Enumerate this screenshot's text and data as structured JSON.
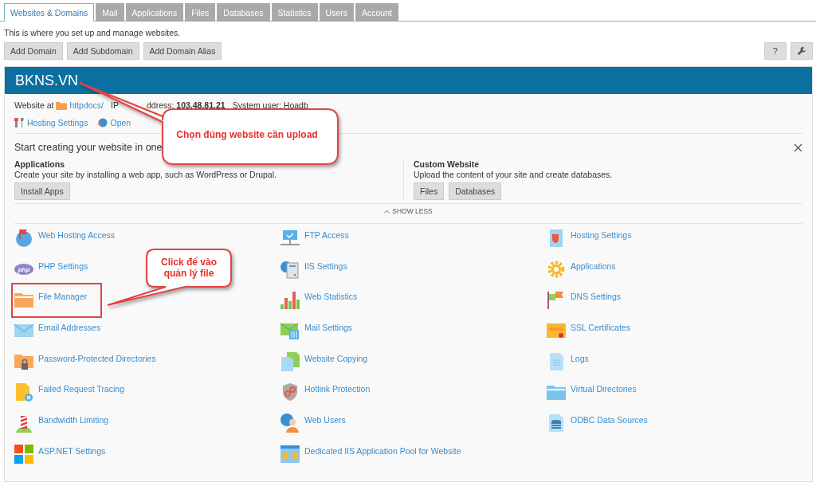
{
  "tabs": [
    {
      "label": "Websites & Domains",
      "selected": true
    },
    {
      "label": "Mail",
      "selected": false
    },
    {
      "label": "Applications",
      "selected": false
    },
    {
      "label": "Files",
      "selected": false
    },
    {
      "label": "Databases",
      "selected": false
    },
    {
      "label": "Statistics",
      "selected": false
    },
    {
      "label": "Users",
      "selected": false
    },
    {
      "label": "Account",
      "selected": false
    }
  ],
  "description": "This is where you set up and manage websites.",
  "toolbar_buttons": [
    "Add Domain",
    "Add Subdomain",
    "Add Domain Alias"
  ],
  "help_button": "?",
  "domain": {
    "name": "BKNS.VN",
    "website_at": "Website at",
    "docroot": "httpdocs/",
    "ip_label": "IP",
    "ip": "ddress: **103.48.81.21**",
    "system_user": "System user: Hoadb",
    "links": [
      "Hosting Settings",
      "Open"
    ]
  },
  "start": {
    "title": "Start creating your website in one",
    "options": [
      {
        "title": "Applications",
        "text": "Create your site by installing a web app, such as WordPress or Drupal.",
        "buttons": [
          "Install Apps"
        ]
      },
      {
        "title": "Custom Website",
        "text": "Upload the content of your site and create databases.",
        "buttons": [
          "Files",
          "Databases"
        ]
      }
    ],
    "toggle": "SHOW LESS"
  },
  "tools": [
    {
      "label": "Web Hosting Access"
    },
    {
      "label": "FTP Access"
    },
    {
      "label": "Hosting Settings"
    },
    {
      "label": "PHP Settings",
      "icon_text": "php"
    },
    {
      "label": "IIS Settings"
    },
    {
      "label": "Applications"
    },
    {
      "label": "File Manager",
      "highlighted": true
    },
    {
      "label": "Web Statistics"
    },
    {
      "label": "DNS Settings"
    },
    {
      "label": "Email Addresses"
    },
    {
      "label": "Mail Settings"
    },
    {
      "label": "SSL Certificates"
    },
    {
      "label": "Password-Protected Directories"
    },
    {
      "label": "Website Copying"
    },
    {
      "label": "Logs"
    },
    {
      "label": "Failed Request Tracing"
    },
    {
      "label": "Hotlink Protection"
    },
    {
      "label": "Virtual Directories"
    },
    {
      "label": "Bandwidth Limiting"
    },
    {
      "label": "Web Users"
    },
    {
      "label": "ODBC Data Sources"
    },
    {
      "label": "ASP.NET Settings"
    },
    {
      "label": "Dedicated IIS Application Pool for Website"
    }
  ],
  "callouts": [
    "Chọn đúng website cần upload",
    "Click để vào\nquản lý file"
  ]
}
